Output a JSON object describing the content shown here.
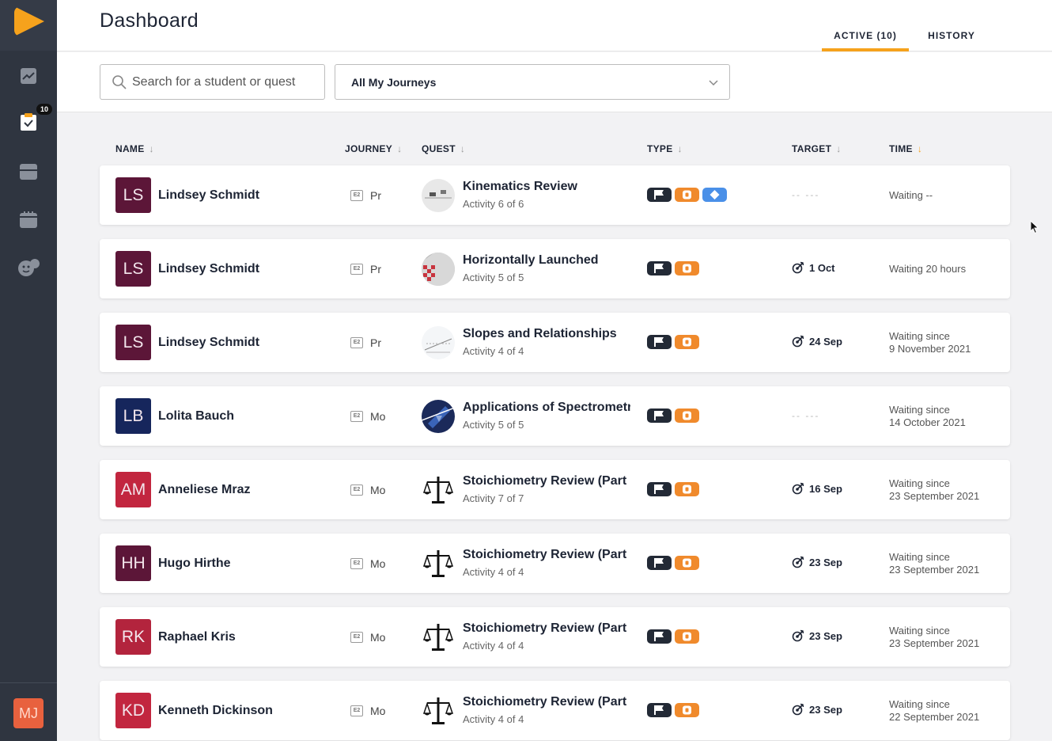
{
  "header": {
    "title": "Dashboard",
    "tabs": [
      {
        "label": "ACTIVE (10)",
        "active": true
      },
      {
        "label": "HISTORY",
        "active": false
      }
    ]
  },
  "sidebar": {
    "badge": "10",
    "user_initials": "MJ",
    "icons": [
      "trend-chart-icon",
      "clipboard-check-icon",
      "card-icon",
      "calendar-icon",
      "faces-icon"
    ]
  },
  "filters": {
    "search_placeholder": "Search for a student or quest",
    "journey_select": "All My Journeys"
  },
  "columns": [
    "NAME",
    "JOURNEY",
    "QUEST",
    "TYPE",
    "TARGET",
    "TIME"
  ],
  "colors": {
    "accent": "#f6a21c",
    "sidebar": "#2f3540",
    "flag_pill": "#232a36",
    "quest_pill": "#f08a2c",
    "diamond_pill": "#4a90e8"
  },
  "rows": [
    {
      "initials": "LS",
      "avatar_color": "#5c1638",
      "name": "Lindsey Schmidt",
      "journey_icon": "E2",
      "journey": "Pr",
      "quest_title": "Kinematics Review",
      "quest_sub": "Activity 6 of 6",
      "types": [
        "flag",
        "quest",
        "diamond"
      ],
      "target": "",
      "target_placeholder": "-- ---",
      "time": [
        "Waiting --"
      ]
    },
    {
      "initials": "LS",
      "avatar_color": "#5c1638",
      "name": "Lindsey Schmidt",
      "journey_icon": "E2",
      "journey": "Pr",
      "quest_title": "Horizontally Launched",
      "quest_sub": "Activity 5 of 5",
      "types": [
        "flag",
        "quest"
      ],
      "target": "1 Oct",
      "time": [
        "Waiting 20 hours"
      ]
    },
    {
      "initials": "LS",
      "avatar_color": "#5c1638",
      "name": "Lindsey Schmidt",
      "journey_icon": "E2",
      "journey": "Pr",
      "quest_title": "Slopes and Relationships",
      "quest_sub": "Activity 4 of 4",
      "types": [
        "flag",
        "quest"
      ],
      "target": "24 Sep",
      "time": [
        "Waiting since",
        "9 November 2021"
      ]
    },
    {
      "initials": "LB",
      "avatar_color": "#16265c",
      "name": "Lolita Bauch",
      "journey_icon": "E2",
      "journey": "Mo",
      "quest_title": "Applications of Spectrometry",
      "quest_sub": "Activity 5 of 5",
      "types": [
        "flag",
        "quest"
      ],
      "target": "",
      "target_placeholder": "-- ---",
      "time": [
        "Waiting since",
        "14 October 2021"
      ]
    },
    {
      "initials": "AM",
      "avatar_color": "#c2263f",
      "name": "Anneliese Mraz",
      "journey_icon": "E2",
      "journey": "Mo",
      "quest_title": "Stoichiometry Review (Part ...",
      "quest_sub": "Activity 7 of 7",
      "types": [
        "flag",
        "quest"
      ],
      "target": "16 Sep",
      "time": [
        "Waiting since",
        "23 September 2021"
      ]
    },
    {
      "initials": "HH",
      "avatar_color": "#5c1638",
      "name": "Hugo Hirthe",
      "journey_icon": "E2",
      "journey": "Mo",
      "quest_title": "Stoichiometry Review (Part ...",
      "quest_sub": "Activity 4 of 4",
      "types": [
        "flag",
        "quest"
      ],
      "target": "23 Sep",
      "time": [
        "Waiting since",
        "23 September 2021"
      ]
    },
    {
      "initials": "RK",
      "avatar_color": "#b3243d",
      "name": "Raphael Kris",
      "journey_icon": "E2",
      "journey": "Mo",
      "quest_title": "Stoichiometry Review (Part ...",
      "quest_sub": "Activity 4 of 4",
      "types": [
        "flag",
        "quest"
      ],
      "target": "23 Sep",
      "time": [
        "Waiting since",
        "23 September 2021"
      ]
    },
    {
      "initials": "KD",
      "avatar_color": "#c2263f",
      "name": "Kenneth Dickinson",
      "journey_icon": "E2",
      "journey": "Mo",
      "quest_title": "Stoichiometry Review (Part ...",
      "quest_sub": "Activity 4 of 4",
      "types": [
        "flag",
        "quest"
      ],
      "target": "23 Sep",
      "time": [
        "Waiting since",
        "22 September 2021"
      ]
    }
  ]
}
